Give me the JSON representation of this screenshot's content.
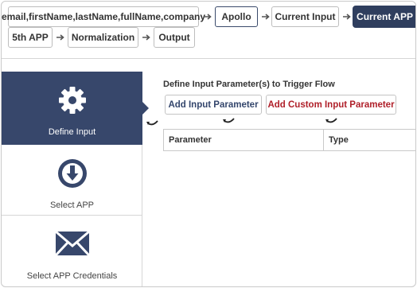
{
  "flow": {
    "steps": [
      {
        "label": "email,firstName,lastName,fullName,company"
      },
      {
        "label": "Apollo"
      },
      {
        "label": "Current Input"
      },
      {
        "label": "Current APP"
      },
      {
        "label": "5th APP"
      },
      {
        "label": "Normalization"
      },
      {
        "label": "Output"
      }
    ]
  },
  "sidebar": {
    "items": [
      {
        "label": "Define Input",
        "icon": "gear-icon",
        "active": true
      },
      {
        "label": "Select APP",
        "icon": "download-circle-icon",
        "active": false
      },
      {
        "label": "Select APP Credentials",
        "icon": "envelope-icon",
        "active": false
      }
    ]
  },
  "main": {
    "section_title": "Define Input Parameter(s) to Trigger Flow",
    "add_parameter_label": "Add Input Parameter",
    "add_custom_parameter_label": "Add Custom Input Parameter",
    "table": {
      "columns": [
        "Parameter",
        "Type"
      ]
    }
  },
  "colors": {
    "accent": "#37476b",
    "danger": "#b0202a"
  }
}
